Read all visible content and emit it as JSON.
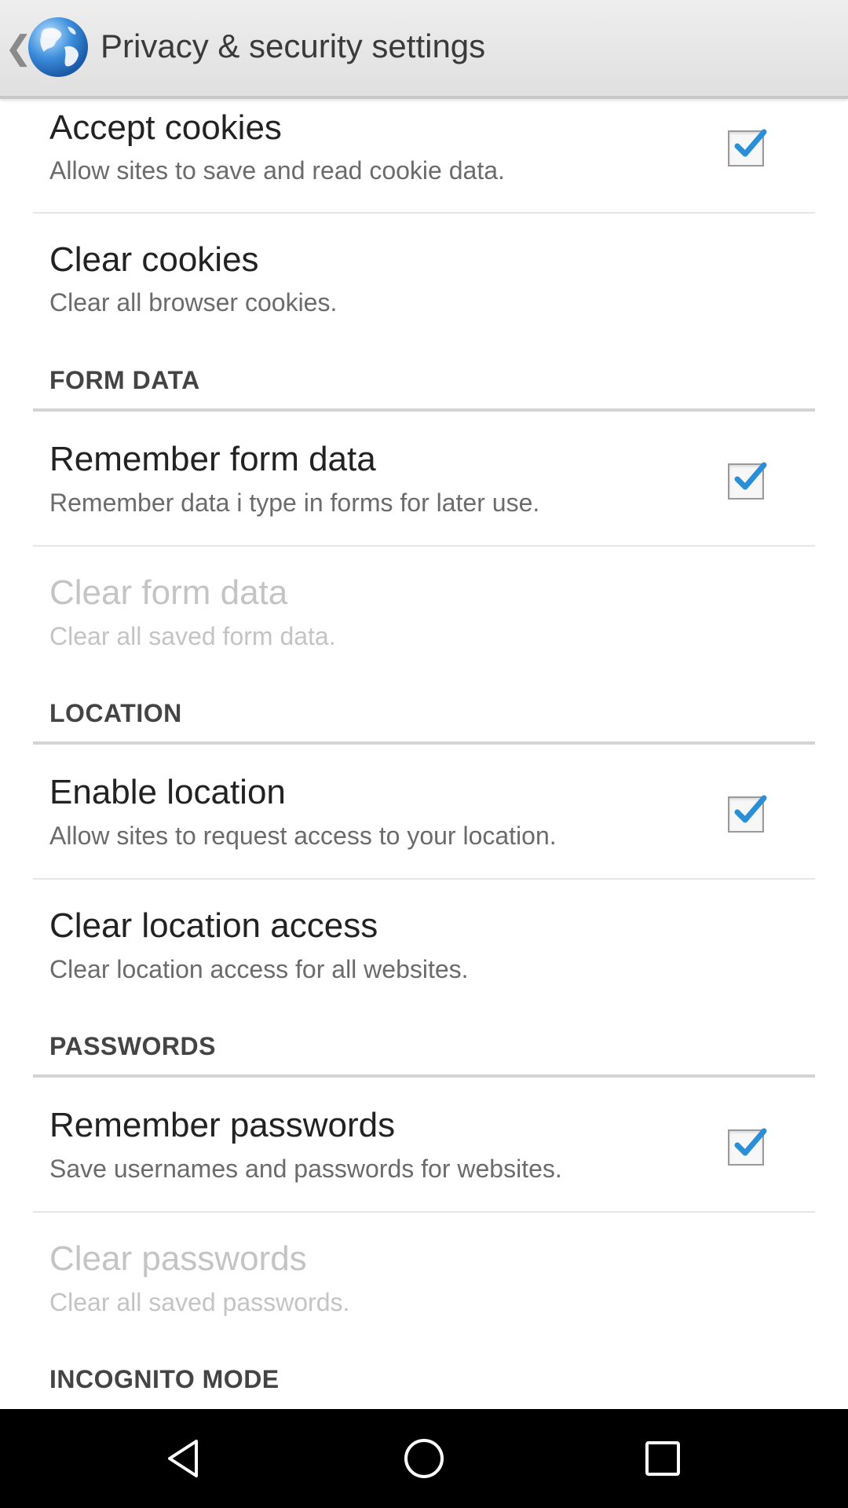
{
  "header": {
    "title": "Privacy & security settings",
    "back_glyph": "❮",
    "icon": "globe-icon"
  },
  "items": [
    {
      "title": "Accept cookies",
      "summary": "Allow sites to save and read cookie data.",
      "checked": true,
      "enabled": true
    },
    {
      "title": "Clear cookies",
      "summary": "Clear all browser cookies.",
      "enabled": true
    },
    {
      "title": "Remember form data",
      "summary": "Remember data i type in forms for later use.",
      "checked": true,
      "enabled": true
    },
    {
      "title": "Clear form data",
      "summary": "Clear all saved form data.",
      "enabled": false
    },
    {
      "title": "Enable location",
      "summary": "Allow sites to request access to your location.",
      "checked": true,
      "enabled": true
    },
    {
      "title": "Clear location access",
      "summary": "Clear location access for all websites.",
      "enabled": true
    },
    {
      "title": "Remember passwords",
      "summary": "Save usernames and passwords for websites.",
      "checked": true,
      "enabled": true
    },
    {
      "title": "Clear passwords",
      "summary": "Clear all saved passwords.",
      "enabled": false
    }
  ],
  "categories": {
    "form_data": "FORM DATA",
    "location": "LOCATION",
    "passwords": "PASSWORDS",
    "incognito": "INCOGNITO MODE"
  },
  "colors": {
    "checkmark": "#2a8fd6",
    "disabled_text": "#c4c4c4",
    "action_bar": "#e6e6e6"
  },
  "nav": {
    "back": "nav-back-icon",
    "home": "nav-home-icon",
    "recents": "nav-recents-icon"
  }
}
